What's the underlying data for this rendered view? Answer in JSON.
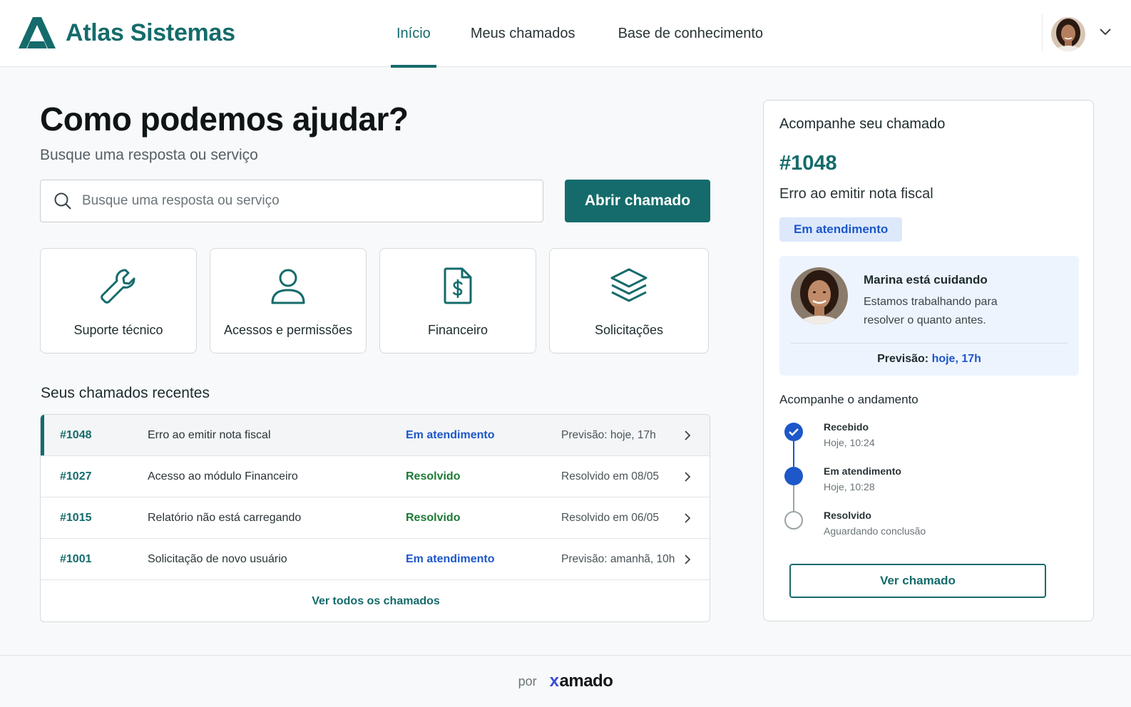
{
  "brand": {
    "name": "Atlas Sistemas",
    "accent_color": "#156b6b",
    "logo_icon": "atlas-logo-icon"
  },
  "nav": {
    "items": [
      {
        "label": "Início",
        "active": true
      },
      {
        "label": "Meus chamados",
        "active": false
      },
      {
        "label": "Base de conhecimento",
        "active": false
      }
    ]
  },
  "user_menu": {
    "avatar": "user-avatar",
    "icon": "chevron-down-icon"
  },
  "hero": {
    "title": "Como podemos ajudar?",
    "subtitle": "Busque uma resposta ou serviço"
  },
  "search": {
    "placeholder": "Busque uma resposta ou serviço",
    "value": "",
    "icon": "search-icon"
  },
  "open_ticket_label": "Abrir chamado",
  "categories": [
    {
      "label": "Suporte técnico",
      "icon": "wrench-icon"
    },
    {
      "label": "Acessos e permissões",
      "icon": "user-icon"
    },
    {
      "label": "Financeiro",
      "icon": "dollar-document-icon"
    },
    {
      "label": "Solicitações",
      "icon": "layers-icon"
    }
  ],
  "recent": {
    "title": "Seus chamados recentes",
    "rows": [
      {
        "id": "#1048",
        "description": "Erro ao emitir nota fiscal",
        "status": "Em atendimento",
        "status_type": "em",
        "forecast": "Previsão: hoje, 17h",
        "selected": true
      },
      {
        "id": "#1027",
        "description": "Acesso ao módulo Financeiro",
        "status": "Resolvido",
        "status_type": "ok",
        "forecast": "Resolvido em 08/05",
        "selected": false
      },
      {
        "id": "#1015",
        "description": "Relatório não está carregando",
        "status": "Resolvido",
        "status_type": "ok",
        "forecast": "Resolvido em 06/05",
        "selected": false
      },
      {
        "id": "#1001",
        "description": "Solicitação de novo usuário",
        "status": "Em atendimento",
        "status_type": "em",
        "forecast": "Previsão: amanhã, 10h",
        "selected": false
      }
    ],
    "view_all_label": "Ver todos os chamados"
  },
  "tracker": {
    "title": "Acompanhe seu chamado",
    "ticket_id": "#1048",
    "ticket_desc": "Erro ao emitir nota fiscal",
    "status_badge": "Em atendimento",
    "agent": {
      "name": "Marina está cuidando",
      "message": "Estamos trabalhando para resolver o quanto antes.",
      "forecast_label": "Previsão:",
      "forecast_value": "hoje, 17h"
    },
    "progress_title": "Acompanhe o andamento",
    "steps": [
      {
        "name": "Recebido",
        "time": "Hoje, 10:24",
        "state": "done"
      },
      {
        "name": "Em atendimento",
        "time": "Hoje, 10:28",
        "state": "current"
      },
      {
        "name": "Resolvido",
        "time": "Aguardando conclusão",
        "state": "pending"
      }
    ],
    "view_button": "Ver chamado"
  },
  "footer": {
    "por": "por",
    "brand_x": "x",
    "brand_rest": "amado"
  },
  "colors": {
    "primary": "#156b6b",
    "blue": "#1d57c9",
    "green": "#1d7a36",
    "badge_bg": "#dde9fb"
  }
}
